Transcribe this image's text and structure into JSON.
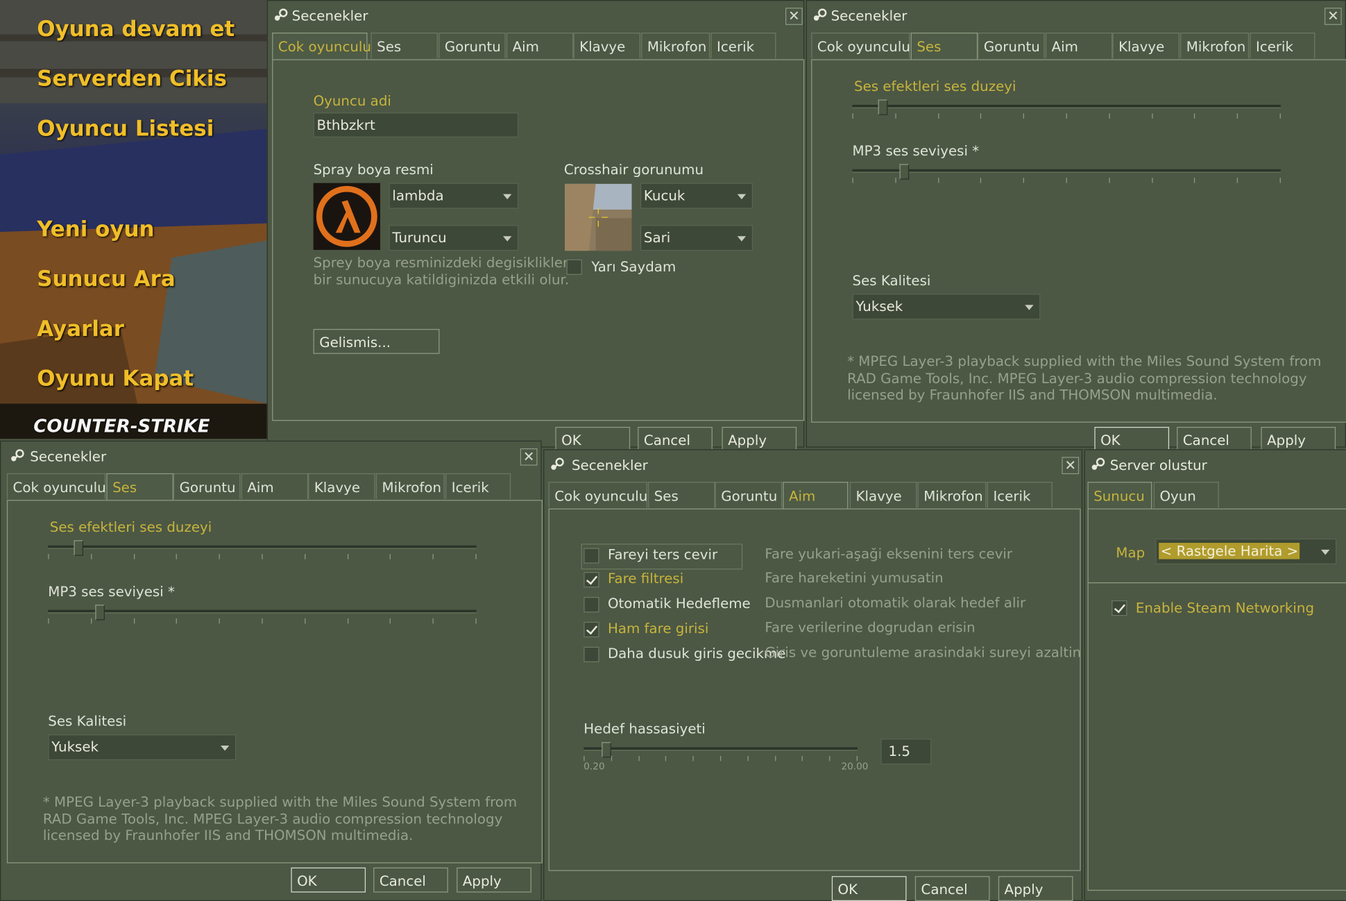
{
  "main_menu": {
    "items": [
      "Oyuna devam et",
      "Serverden Cikis",
      "Oyuncu Listesi",
      "Yeni oyun",
      "Sunucu Ara",
      "Ayarlar",
      "Oyunu Kapat"
    ],
    "logo_text": "COUNTER-STRIKE"
  },
  "tabs": [
    "Cok oyunculu",
    "Ses",
    "Goruntu",
    "Aim",
    "Klavye",
    "Mikrofon",
    "Icerik"
  ],
  "buttons": {
    "ok": "OK",
    "cancel": "Cancel",
    "apply": "Apply"
  },
  "dialog_title": "Secenekler",
  "multiplayer": {
    "player_name_label": "Oyuncu adi",
    "player_name_value": "Bthbzkrt",
    "spray_label": "Spray boya resmi",
    "spray_image": "lambda",
    "spray_color": "Turuncu",
    "spray_note_1": "Sprey boya resminizdeki degisiklikler",
    "spray_note_2": "bir sunucuya katildiginizda etkili olur.",
    "crosshair_label": "Crosshair gorunumu",
    "crosshair_size": "Kucuk",
    "crosshair_color": "Sari",
    "translucent_label": "Yarı Saydam",
    "translucent_checked": false,
    "advanced_button": "Gelismis..."
  },
  "sound": {
    "effects_label": "Ses efektleri ses duzeyi",
    "effects_level": 0.06,
    "mp3_label": "MP3 ses seviyesi",
    "mp3_asterisk": "*",
    "mp3_level": 0.11,
    "quality_label": "Ses Kalitesi",
    "quality_value": "Yuksek",
    "note_1": "* MPEG Layer-3 playback supplied with the Miles Sound System from",
    "note_2": "RAD Game Tools, Inc. MPEG Layer-3 audio compression technology",
    "note_3": "licensed by Fraunhofer IIS and THOMSON multimedia."
  },
  "aim": {
    "options": [
      {
        "label": "Fareyi ters cevir",
        "checked": false,
        "desc": "Fare yukari-aşaği eksenini ters cevir"
      },
      {
        "label": "Fare filtresi",
        "checked": true,
        "desc": "Fare hareketini yumusatin"
      },
      {
        "label": "Otomatik Hedefleme",
        "checked": false,
        "desc": "Dusmanlari otomatik olarak hedef alir"
      },
      {
        "label": "Ham fare girisi",
        "checked": true,
        "desc": "Fare verilerine dogrudan erisin"
      },
      {
        "label": "Daha dusuk giris gecikme",
        "checked": false,
        "desc": "Giris ve goruntuleme arasindaki sureyi azaltin"
      }
    ],
    "sensitivity_label": "Hedef hassasiyeti",
    "sensitivity_min": "0.20",
    "sensitivity_max": "20.00",
    "sensitivity_value": "1.5",
    "sensitivity_level": 0.065
  },
  "server": {
    "title": "Server olustur",
    "tabs": [
      "Sunucu",
      "Oyun"
    ],
    "map_label": "Map",
    "map_value": "< Rastgele Harita >",
    "steam_label": "Enable Steam Networking",
    "steam_checked": true
  }
}
